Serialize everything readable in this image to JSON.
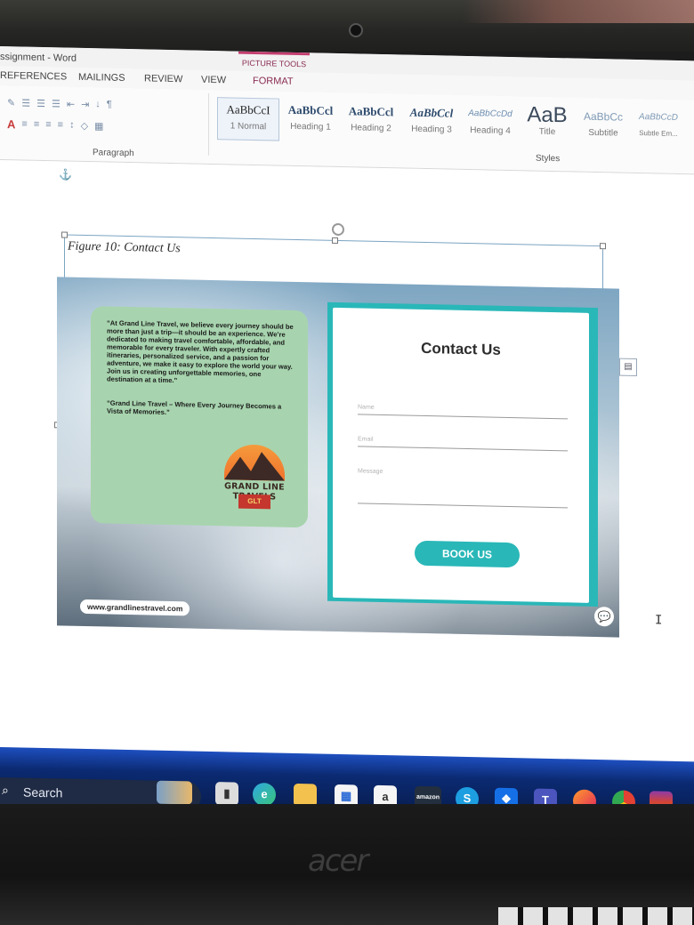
{
  "window": {
    "title": "ssignment - Word",
    "picture_tools": "PICTURE TOOLS"
  },
  "tabs": [
    "REFERENCES",
    "MAILINGS",
    "REVIEW",
    "VIEW",
    "FORMAT"
  ],
  "ribbon": {
    "paragraph_label": "Paragraph",
    "styles_label": "Styles",
    "style_gallery": [
      {
        "sample": "AaBbCcI",
        "name": "1 Normal"
      },
      {
        "sample": "AaBbCcl",
        "name": "Heading 1"
      },
      {
        "sample": "AaBbCcl",
        "name": "Heading 2"
      },
      {
        "sample": "AaBbCcl",
        "name": "Heading 3"
      },
      {
        "sample": "AaBbCcDd",
        "name": "Heading 4"
      },
      {
        "sample": "AaB",
        "name": "Title"
      },
      {
        "sample": "AaBbCc",
        "name": "Subtitle"
      },
      {
        "sample": "AaBbCcD",
        "name": "Subtle Em..."
      }
    ]
  },
  "document": {
    "caption": "Figure 10: Contact Us",
    "poster": {
      "quote": "“At Grand Line Travel, we believe every journey should be more than just a trip—it should be an experience. We’re dedicated to making travel comfortable, affordable, and memorable for every traveler. With expertly crafted itineraries, personalized service, and a passion for adventure, we make it easy to explore the world your way. Join us in creating unforgettable memories, one destination at a time.”",
      "tagline": "“Grand Line Travel – Where Every Journey Becomes a Vista of Memories.”",
      "brand_name": "GRAND LINE TRAVELS",
      "brand_badge": "GLT",
      "contact_title": "Contact Us",
      "fields": {
        "name": "Name",
        "email": "Email",
        "message": "Message"
      },
      "button_label": "BOOK US",
      "website": "www.grandlinestravel.com"
    }
  },
  "taskbar": {
    "search_label": "Search",
    "icons": [
      "widgets-icon",
      "file-explorer-icon",
      "edge-icon",
      "folder-icon",
      "store-icon",
      "amazon-appstore-icon",
      "amazon-icon",
      "skype-icon",
      "dropbox-icon",
      "teams-icon",
      "firefox-icon",
      "chrome-icon",
      "winrar-icon"
    ]
  },
  "device": {
    "brand": "acer"
  },
  "colors": {
    "accent_teal": "#2ab7b8",
    "card_green": "#a7d4ae",
    "taskbar_blue": "#0b2a72",
    "picture_tools": "#c43f70"
  }
}
